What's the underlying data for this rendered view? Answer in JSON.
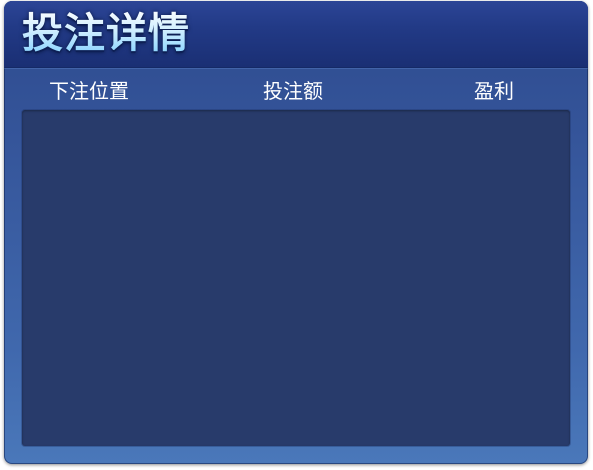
{
  "panel": {
    "title": "投注详情"
  },
  "columns": {
    "position": "下注位置",
    "amount": "投注额",
    "profit": "盈利"
  },
  "rows": []
}
